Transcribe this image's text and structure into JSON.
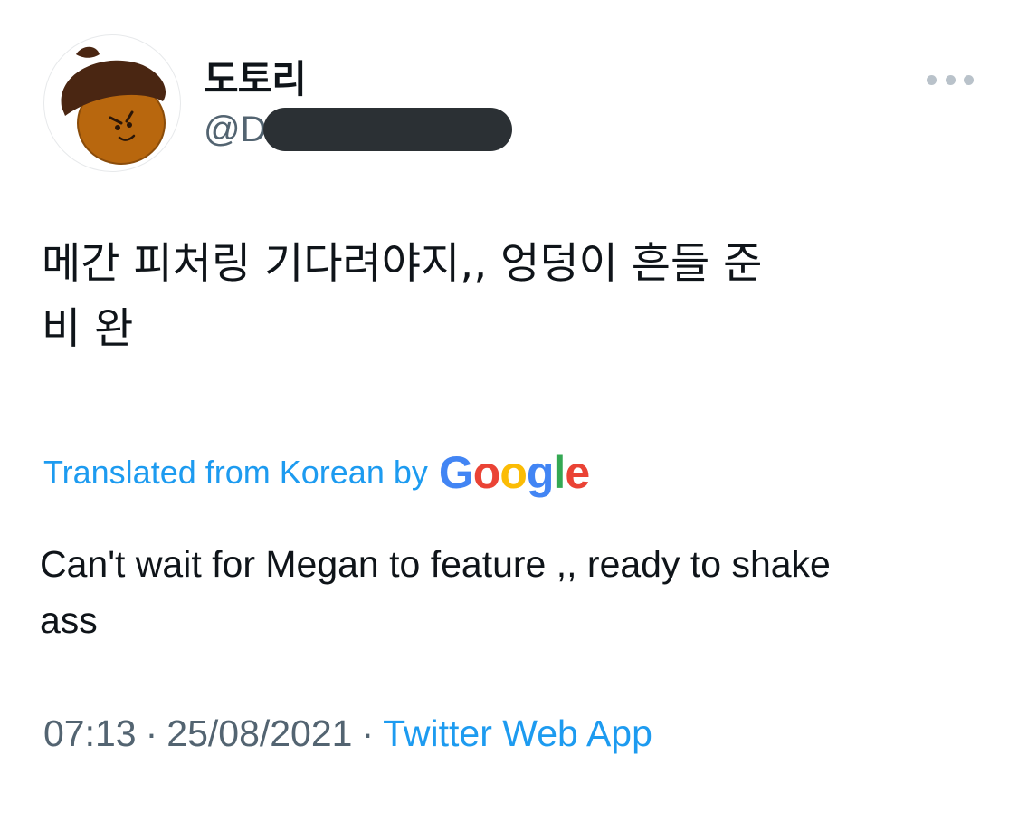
{
  "profile": {
    "display_name": "도토리",
    "handle_visible": "@D",
    "avatar_icon": "acorn-avatar-icon"
  },
  "more_icon": "more-horizontal-icon",
  "tweet": {
    "text_line1": "메간 피처링 기다려야지,, 엉덩이 흔들 준",
    "text_line2": "비 완"
  },
  "translation": {
    "label": "Translated from Korean by",
    "provider_logo_letters": [
      "G",
      "o",
      "o",
      "g",
      "l",
      "e"
    ],
    "text_line1": "Can't wait for Megan to feature ,, ready to shake",
    "text_line2": "ass"
  },
  "meta": {
    "time": "07:13",
    "separator": "·",
    "date": "25/08/2021",
    "source": "Twitter Web App"
  },
  "colors": {
    "link": "#1d9bf0",
    "secondary_text": "#536471",
    "primary_text": "#0f1419"
  }
}
